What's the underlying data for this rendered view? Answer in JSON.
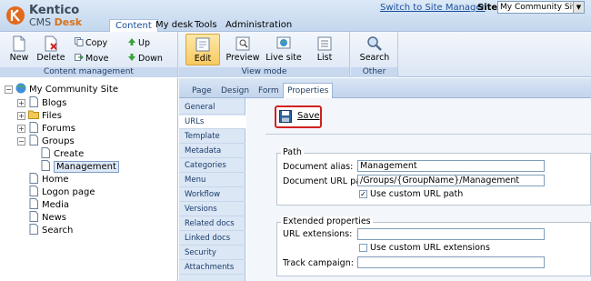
{
  "header": {
    "logo_line1": "Kentico",
    "logo_line2_prefix": "CMS",
    "logo_line2_suffix": "Desk",
    "switch_link": "Switch to Site Manager",
    "site_label": "Site:",
    "site_value": "My Community Site",
    "tabs": [
      {
        "label": "Content",
        "active": true
      },
      {
        "label": "My desk"
      },
      {
        "label": "Tools"
      },
      {
        "label": "Administration"
      }
    ]
  },
  "toolbar": {
    "content_management": {
      "label": "Content management",
      "new": "New",
      "delete": "Delete",
      "copy": "Copy",
      "move": "Move",
      "up": "Up",
      "down": "Down"
    },
    "view_mode": {
      "label": "View mode",
      "edit": "Edit",
      "preview": "Preview",
      "live_site": "Live site",
      "list": "List"
    },
    "other": {
      "label": "Other",
      "search": "Search"
    }
  },
  "tree": {
    "root": "My Community Site",
    "items": [
      {
        "label": "Blogs"
      },
      {
        "label": "Files"
      },
      {
        "label": "Forums"
      },
      {
        "label": "Groups"
      },
      {
        "label": "Create"
      },
      {
        "label": "Management",
        "selected": true
      },
      {
        "label": "Home"
      },
      {
        "label": "Logon page"
      },
      {
        "label": "Media"
      },
      {
        "label": "News"
      },
      {
        "label": "Search"
      }
    ]
  },
  "subtabs": [
    "Page",
    "Design",
    "Form",
    "Properties"
  ],
  "vmenu": [
    "General",
    "URLs",
    "Template",
    "Metadata",
    "Categories",
    "Menu",
    "Workflow",
    "Versions",
    "Related docs",
    "Linked docs",
    "Security",
    "Attachments"
  ],
  "form": {
    "save_label": "Save",
    "path": {
      "legend": "Path",
      "doc_alias_label": "Document alias:",
      "doc_alias_value": "Management",
      "doc_url_label": "Document URL path:",
      "doc_url_value": "/Groups/{GroupName}/Management",
      "use_custom_label": "Use custom URL path",
      "use_custom_checked": true
    },
    "extended": {
      "legend": "Extended properties",
      "url_ext_label": "URL extensions:",
      "url_ext_value": "",
      "use_custom_ext_label": "Use custom URL extensions",
      "use_custom_ext_checked": false,
      "track_label": "Track campaign:",
      "track_value": ""
    }
  }
}
